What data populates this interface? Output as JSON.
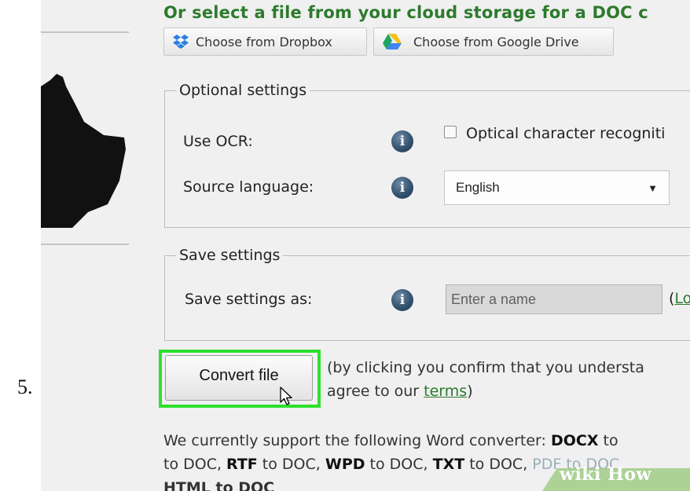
{
  "step": {
    "number": "5."
  },
  "cloud": {
    "title": "Or select a file from your cloud storage for a DOC c",
    "dropbox_label": "Choose from Dropbox",
    "gdrive_label": "Choose from Google Drive"
  },
  "optional_settings": {
    "legend": "Optional settings",
    "ocr_label": "Use OCR:",
    "ocr_checkbox_label": "Optical character recogniti",
    "ocr_checked": false,
    "source_language_label": "Source language:",
    "source_language_value": "English"
  },
  "save_settings": {
    "legend": "Save settings",
    "save_as_label": "Save settings as:",
    "name_placeholder": "Enter a name",
    "load_link_paren": "(",
    "load_link_partial": "Lo"
  },
  "convert": {
    "button_label": "Convert file",
    "confirm_line1": "(by clicking you confirm that you understa",
    "confirm_line2_prefix": "agree to our ",
    "terms_link": "terms",
    "confirm_line2_suffix": ")"
  },
  "support": {
    "line1_prefix": "We currently support the following Word converter: ",
    "line1_bold": "DOCX",
    "line1_suffix": " to",
    "line2": [
      {
        "text": "to DOC, ",
        "bold": false
      },
      {
        "text": "RTF",
        "bold": true
      },
      {
        "text": " to DOC, ",
        "bold": false
      },
      {
        "text": "WPD",
        "bold": true
      },
      {
        "text": " to DOC, ",
        "bold": false
      },
      {
        "text": "TXT",
        "bold": true
      },
      {
        "text": " to DOC, ",
        "bold": false
      },
      {
        "text": "PDF to DOC",
        "bold": false,
        "faint": true
      }
    ],
    "line3": "HTML to DOC"
  },
  "watermark": {
    "text": "wiki How"
  },
  "colors": {
    "accent_green": "#2d7a2d",
    "highlight_green": "#2ee02e",
    "info_icon": "#34536f"
  }
}
